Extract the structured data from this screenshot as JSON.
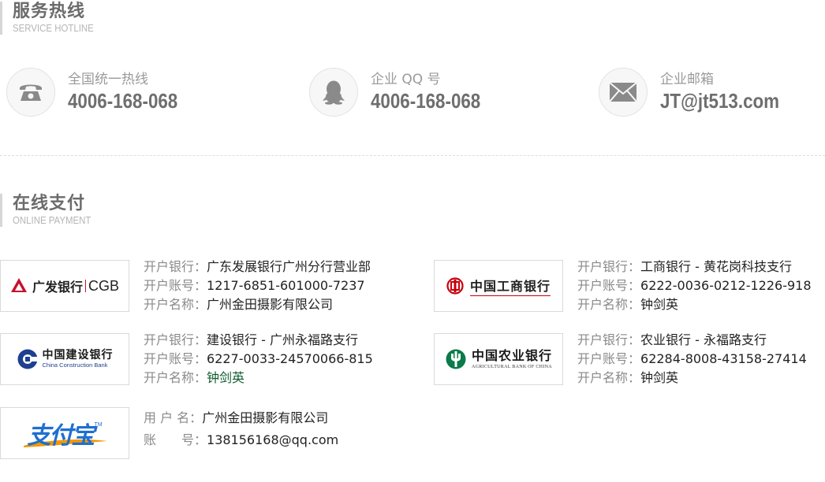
{
  "service": {
    "title": "服务热线",
    "subtitle": "SERVICE HOTLINE",
    "items": [
      {
        "icon": "phone-icon",
        "label": "全国统一热线",
        "value": "4006-168-068"
      },
      {
        "icon": "qq-icon",
        "label": "企业 QQ 号",
        "value": "4006-168-068"
      },
      {
        "icon": "mail-icon",
        "label": "企业邮箱",
        "value": "JT@jt513.com"
      }
    ]
  },
  "payment": {
    "title": "在线支付",
    "subtitle": "ONLINE PAYMENT",
    "banks": [
      {
        "logo_text": "广发银行",
        "logo_text2": "CGB",
        "rows": [
          {
            "k": "开户银行：",
            "v": "广东发展银行广州分行营业部"
          },
          {
            "k": "开户账号：",
            "v": "1217-6851-601000-7237"
          },
          {
            "k": "开户名称：",
            "v": "广州金田摄影有限公司"
          }
        ]
      },
      {
        "logo_text": "中国工商银行",
        "rows": [
          {
            "k": "开户银行：",
            "v": "工商银行 - 黄花岗科技支行"
          },
          {
            "k": "开户账号：",
            "v": "6222-0036-0212-1226-918"
          },
          {
            "k": "开户名称：",
            "v": "钟剑英"
          }
        ]
      },
      {
        "logo_text": "中国建设银行",
        "logo_text2": "China Construction Bank",
        "rows": [
          {
            "k": "开户银行：",
            "v": "建设银行 - 广州永福路支行"
          },
          {
            "k": "开户账号：",
            "v": "6227-0033-24570066-815"
          },
          {
            "k": "开户名称：",
            "v": "钟剑英"
          }
        ]
      },
      {
        "logo_text": "中国农业银行",
        "logo_text2": "AGRICULTURAL BANK OF CHINA",
        "rows": [
          {
            "k": "开户银行：",
            "v": "农业银行 - 永福路支行"
          },
          {
            "k": "开户账号：",
            "v": "62284-8008-43158-27414"
          },
          {
            "k": "开户名称：",
            "v": "钟剑英"
          }
        ]
      },
      {
        "logo_text": "支付宝",
        "logo_tm": "TM",
        "rows": [
          {
            "k": "用 户 名：",
            "v": "广州金田摄影有限公司"
          },
          {
            "k": "账　　号：",
            "v": "138156168@qq.com"
          }
        ]
      }
    ]
  },
  "colors": {
    "cgb_red": "#c8102e",
    "icbc_red": "#c7000b",
    "ccb_blue": "#1f3f8f",
    "abc_green": "#0c7a4a",
    "alipay_blue": "#1e6fd1",
    "alipay_orange": "#f39800"
  }
}
